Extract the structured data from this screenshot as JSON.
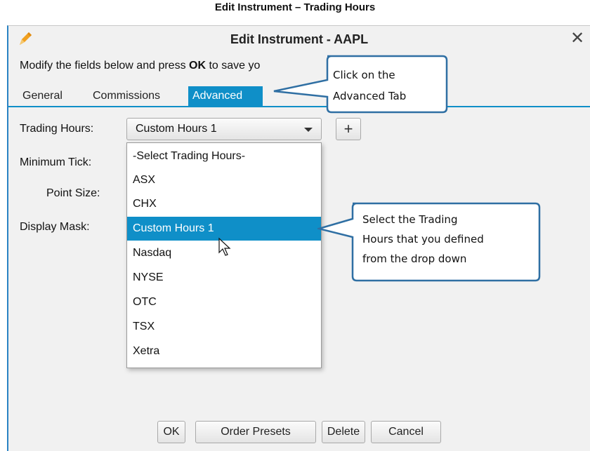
{
  "document": {
    "title": "Edit Instrument – Trading Hours"
  },
  "dialog": {
    "title": "Edit Instrument - AAPL",
    "close_glyph": "✕",
    "instructions_prefix": "Modify the fields below and press ",
    "instructions_bold": "OK",
    "instructions_suffix": " to save yo"
  },
  "tabs": [
    {
      "label": "General",
      "active": false
    },
    {
      "label": "Commissions",
      "active": false
    },
    {
      "label": "Advanced",
      "active": true
    }
  ],
  "fields": {
    "trading_hours_label": "Trading Hours:",
    "minimum_tick_label": "Minimum Tick:",
    "point_size_label": "Point Size:",
    "display_mask_label": "Display Mask:",
    "trading_hours_value": "Custom Hours 1",
    "add_glyph": "+"
  },
  "dropdown": {
    "options": [
      "-Select Trading Hours-",
      "ASX",
      "CHX",
      "Custom Hours 1",
      "Nasdaq",
      "NYSE",
      "OTC",
      "TSX",
      "Xetra"
    ],
    "selected_index": 3
  },
  "callouts": {
    "advanced_tab": {
      "line1": "Click on the",
      "line2": "Advanced Tab"
    },
    "trading_hours": {
      "line1": "Select the Trading",
      "line2": "Hours that you defined",
      "line3": "from the drop down"
    }
  },
  "buttons": {
    "ok": "OK",
    "order_presets": "Order Presets",
    "delete": "Delete",
    "cancel": "Cancel"
  },
  "colors": {
    "accent": "#0f8fc8",
    "callout_border": "#2f6fa3",
    "dialog_border": "#2a83c4",
    "pencil": "#f0a020"
  },
  "icons": {
    "edit": "pencil-icon",
    "close": "close-icon",
    "cursor": "mouse-pointer-icon"
  }
}
